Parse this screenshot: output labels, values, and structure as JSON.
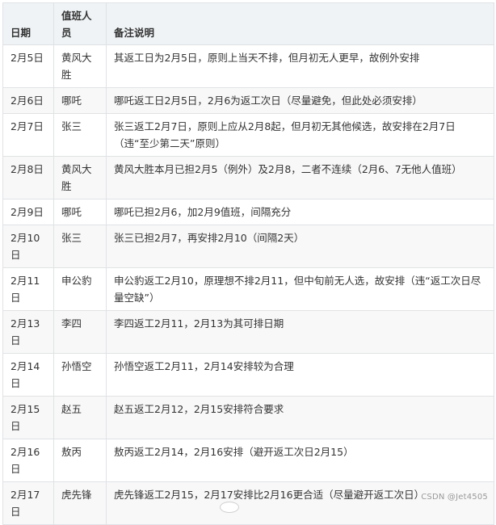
{
  "table": {
    "headers": [
      "日期",
      "值班人员",
      "备注说明"
    ],
    "rows": [
      {
        "date": "2月5日",
        "person": "黄风大胜",
        "note": "其返工日为2月5日，原则上当天不排，但月初无人更早，故例外安排"
      },
      {
        "date": "2月6日",
        "person": "哪吒",
        "note": "哪吒返工日2月5日，2月6为返工次日（尽量避免，但此处必须安排）"
      },
      {
        "date": "2月7日",
        "person": "张三",
        "note": "张三返工2月7日，原则上应从2月8起，但月初无其他候选，故安排在2月7日（违“至少第二天”原则）"
      },
      {
        "date": "2月8日",
        "person": "黄风大胜",
        "note": "黄风大胜本月已担2月5（例外）及2月8，二者不连续（2月6、7无他人值班）"
      },
      {
        "date": "2月9日",
        "person": "哪吒",
        "note": "哪吒已担2月6，加2月9值班，间隔充分"
      },
      {
        "date": "2月10日",
        "person": "张三",
        "note": "张三已担2月7，再安排2月10（间隔2天）"
      },
      {
        "date": "2月11日",
        "person": "申公豹",
        "note": "申公豹返工2月10，原理想不排2月11，但中旬前无人选，故安排（违“返工次日尽量空缺”）"
      },
      {
        "date": "2月13日",
        "person": "李四",
        "note": "李四返工2月11，2月13为其可排日期"
      },
      {
        "date": "2月14日",
        "person": "孙悟空",
        "note": "孙悟空返工2月11，2月14安排较为合理"
      },
      {
        "date": "2月15日",
        "person": "赵五",
        "note": "赵五返工2月12，2月15安排符合要求"
      },
      {
        "date": "2月16日",
        "person": "敖丙",
        "note": "敖丙返工2月14，2月16安排（避开返工次日2月15）"
      },
      {
        "date": "2月17日",
        "person": "虎先锋",
        "note": "虎先锋返工2月15，2月17安排比2月16更合适（尽量避开返工次日）"
      }
    ]
  },
  "watermark": "CSDN @Jet4505"
}
